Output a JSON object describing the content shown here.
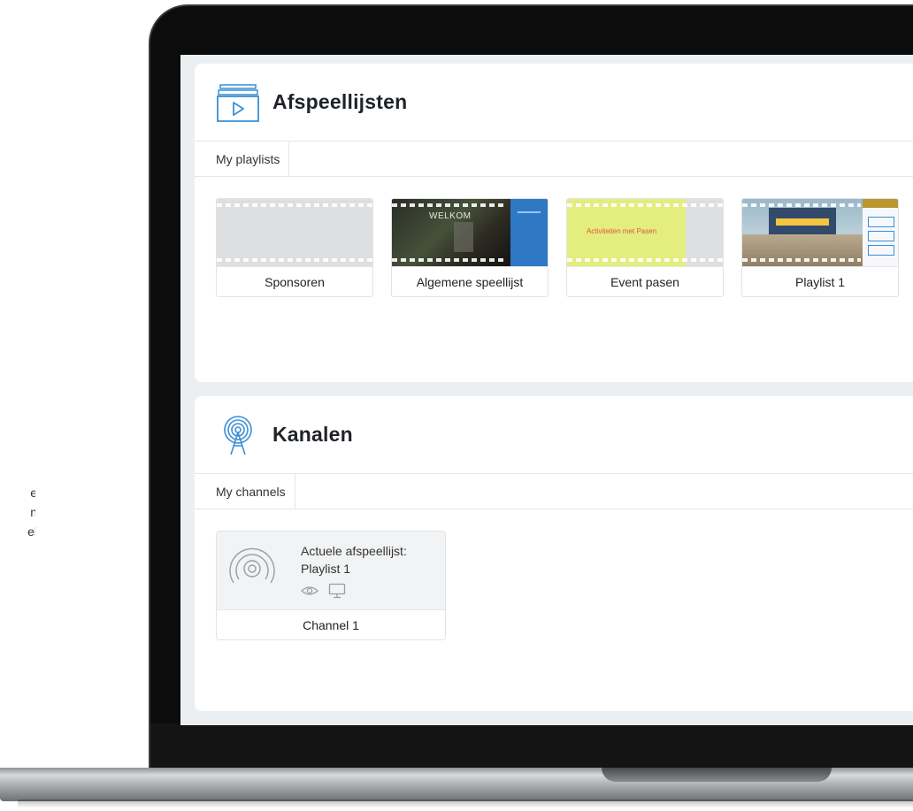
{
  "side_text": {
    "line1": "e",
    "line2": "n",
    "line3": "el"
  },
  "playlists_section": {
    "title": "Afspeellijsten",
    "tab": "My playlists",
    "items": [
      {
        "label": "Sponsoren"
      },
      {
        "label": "Algemene speellijst",
        "thumb_text": "WELKOM"
      },
      {
        "label": "Event pasen",
        "thumb_text": "Activiteiten met Pasen"
      },
      {
        "label": "Playlist 1"
      }
    ]
  },
  "channels_section": {
    "title": "Kanalen",
    "tab": "My channels",
    "channel": {
      "current_label": "Actuele afspeellijst:",
      "current_playlist": "Playlist 1",
      "name": "Channel 1"
    }
  },
  "colors": {
    "accent_blue": "#3a8fd6",
    "thumb_yellow": "#e3ee7f",
    "thumb_red_text": "#e2553a"
  }
}
